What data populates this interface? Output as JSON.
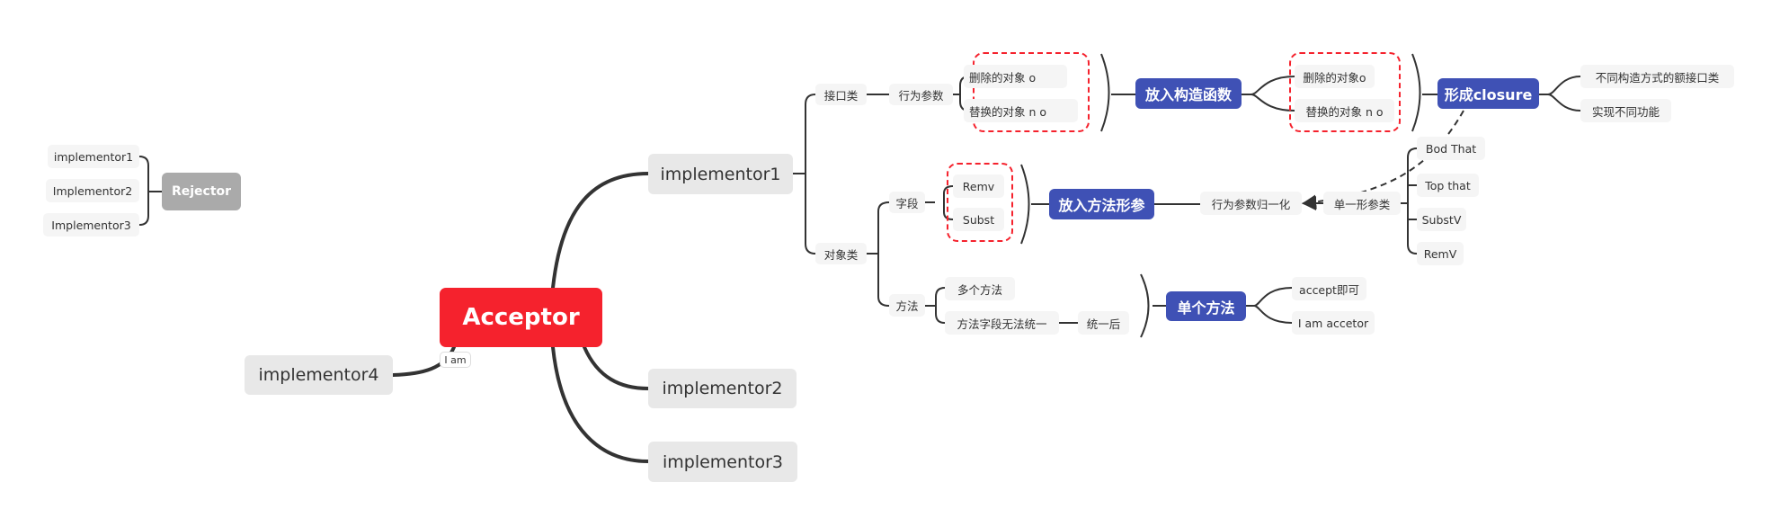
{
  "colors": {
    "root": "#f5222d",
    "summary": "#3f51b5",
    "branch": "#e8e8e8",
    "floating": "#aaaaaa",
    "boundary": "#f5222d",
    "line": "#333333"
  },
  "root": {
    "label": "Acceptor"
  },
  "main_topics": [
    {
      "label": "implementor1"
    },
    {
      "label": "implementor2"
    },
    {
      "label": "implementor3"
    },
    {
      "label": "implementor4",
      "relation_label": "I am"
    }
  ],
  "floating": {
    "label": "Rejector",
    "children": [
      "implementor1",
      "Implementor2",
      "Implementor3"
    ]
  },
  "implementor1": {
    "interface": {
      "label": "接口类",
      "param": "行为参数",
      "items": [
        "删除的对象 o",
        "替换的对象 n o"
      ],
      "summary": "放入构造函数",
      "items2": [
        "删除的对象o",
        "替换的对象 n o"
      ],
      "summary2": "形成closure",
      "results": [
        "不同构造方式的额接口类",
        "实现不同功能"
      ]
    },
    "object": {
      "label": "对象类",
      "field": {
        "label": "字段",
        "items": [
          "Remv",
          "Subst"
        ],
        "summary": "放入方法形参",
        "next": "行为参数归一化",
        "single": "单一形参类",
        "single_items": [
          "Bod That",
          "Top that",
          "SubstV",
          "RemV"
        ]
      },
      "method": {
        "label": "方法",
        "items": [
          "多个方法",
          "方法字段无法统一"
        ],
        "unified": "统一后",
        "summary": "单个方法",
        "results": [
          "accept即可",
          "I am accetor"
        ]
      }
    }
  }
}
